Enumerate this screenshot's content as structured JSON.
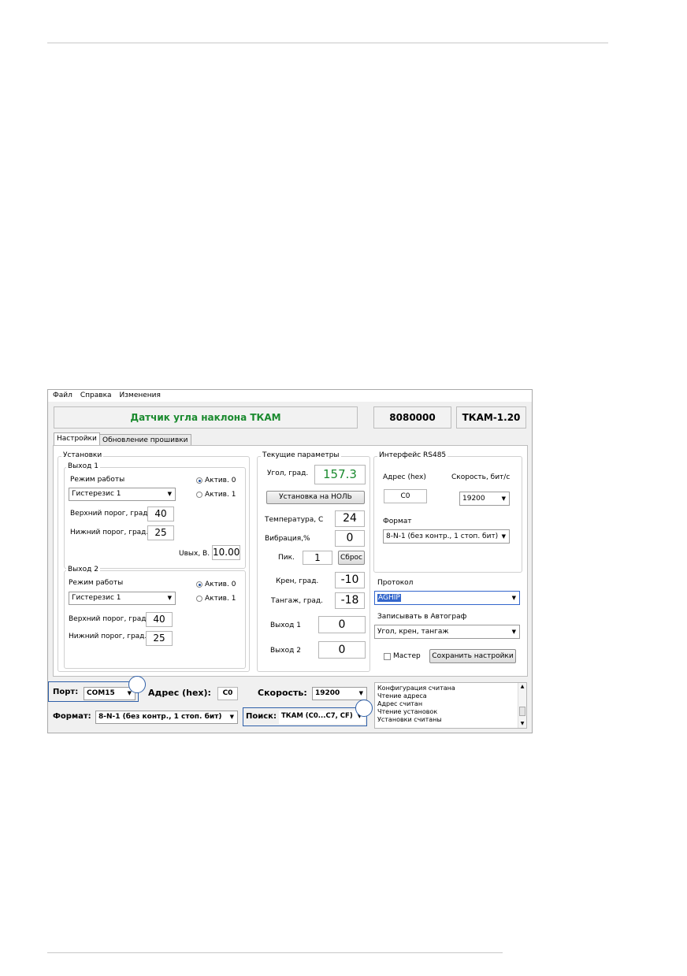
{
  "menu": [
    "Файл",
    "Справка",
    "Изменения"
  ],
  "header": {
    "title": "Датчик угла наклона ТКАМ",
    "serial": "8080000",
    "version": "ТКАМ-1.20"
  },
  "tabs": [
    "Настройки",
    "Обновление прошивки"
  ],
  "settings": {
    "title": "Установки",
    "output1": {
      "title": "Выход 1",
      "mode_label": "Режим работы",
      "mode_value": "Гистерезис 1",
      "active0": "Актив. 0",
      "active1": "Актив. 1",
      "upper_label": "Верхний порог, град.",
      "upper_value": "40",
      "lower_label": "Нижний порог, град.",
      "lower_value": "25",
      "uout_label": "Uвых, В.",
      "uout_value": "10.00"
    },
    "output2": {
      "title": "Выход 2",
      "mode_label": "Режим работы",
      "mode_value": "Гистерезис 1",
      "active0": "Актив. 0",
      "active1": "Актив. 1",
      "upper_label": "Верхний порог, град.",
      "upper_value": "40",
      "lower_label": "Нижний порог, град.",
      "lower_value": "25"
    }
  },
  "current": {
    "title": "Текущие параметры",
    "angle_label": "Угол, град.",
    "angle_value": "157.3",
    "zero_button": "Установка на НОЛЬ",
    "temp_label": "Температура, С",
    "temp_value": "24",
    "vib_label": "Вибрация,%",
    "vib_value": "0",
    "peak_label": "Пик.",
    "peak_value": "1",
    "reset_button": "Сброс",
    "roll_label": "Крен, град.",
    "roll_value": "-10",
    "pitch_label": "Тангаж, град.",
    "pitch_value": "-18",
    "out1_label": "Выход 1",
    "out1_value": "0",
    "out2_label": "Выход 2",
    "out2_value": "0"
  },
  "rs485": {
    "title": "Интерфейс RS485",
    "addr_label": "Адрес (hex)",
    "addr_value": "C0",
    "speed_label": "Скорость, бит/с",
    "speed_value": "19200",
    "format_label": "Формат",
    "format_value": "8-N-1 (без контр., 1 стоп. бит)"
  },
  "protocol": {
    "label": "Протокол",
    "value": "AGHIP",
    "write_label": "Записывать в Автограф",
    "write_value": "Угол, крен, тангаж",
    "master_label": "Мастер",
    "save_button": "Сохранить настройки"
  },
  "bottom": {
    "port_label": "Порт:",
    "port_value": "COM15",
    "addr_label": "Адрес (hex):",
    "addr_value": "C0",
    "speed_label": "Скорость:",
    "speed_value": "19200",
    "format_label": "Формат:",
    "format_value": "8-N-1 (без контр., 1 стоп. бит)",
    "search_label": "Поиск:",
    "search_value": "ТКАМ (C0...C7, CF)"
  },
  "log": [
    "Конфигурация считана",
    "Чтение адреса",
    "Адрес считан",
    "Чтение установок",
    "Установки считаны"
  ],
  "colors": {
    "title_green": "#1a8a2e",
    "highlight_blue": "#3366cc",
    "callout_blue": "#2e5fa8"
  }
}
